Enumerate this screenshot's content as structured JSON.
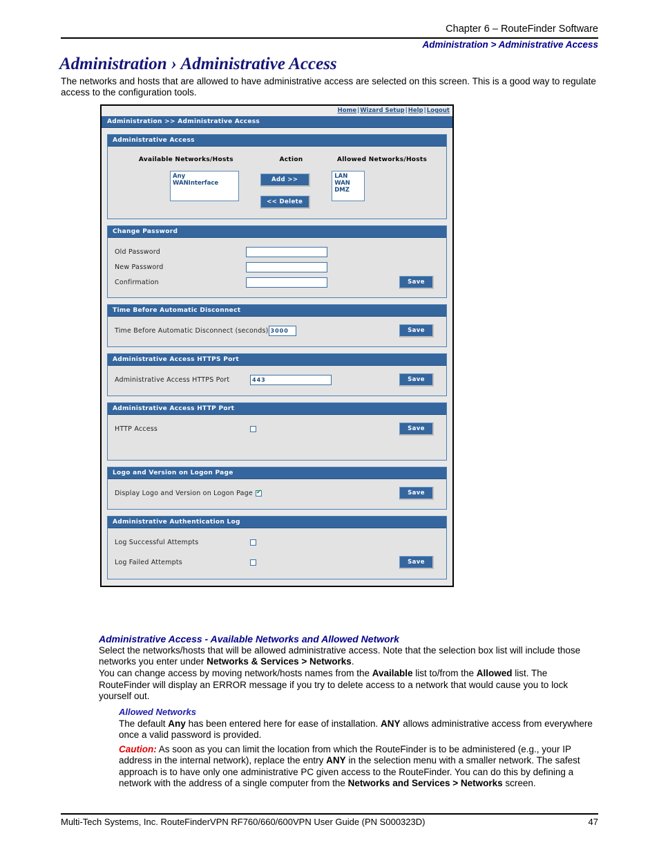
{
  "header": {
    "chapter": "Chapter 6 – RouteFinder Software",
    "breadcrumb": "Administration > Administrative Access"
  },
  "page_title": "Administration › Administrative Access",
  "intro": "The networks and hosts that are allowed to have administrative access are selected on this screen. This is a good way to regulate access to the configuration tools.",
  "screenshot": {
    "topnav": {
      "home": "Home",
      "wizard": "Wizard Setup",
      "help": "Help",
      "logout": "Logout",
      "separator": "|"
    },
    "breadcrumb_bar": "Administration >> Administrative Access",
    "panels": {
      "admin_access": {
        "title": "Administrative Access",
        "col_available": "Available Networks/Hosts",
        "col_action": "Action",
        "col_allowed": "Allowed Networks/Hosts",
        "available_items": [
          "Any",
          "WANInterface"
        ],
        "allowed_items": [
          "LAN",
          "WAN",
          "DMZ"
        ],
        "add_button": "Add  >>",
        "delete_button": "<< Delete"
      },
      "change_password": {
        "title": "Change Password",
        "old_label": "Old Password",
        "old_value": "",
        "new_label": "New Password",
        "new_value": "",
        "confirm_label": "Confirmation",
        "confirm_value": "",
        "save": "Save"
      },
      "auto_disconnect": {
        "title": "Time Before Automatic Disconnect",
        "label": "Time Before Automatic Disconnect (seconds)",
        "value": "3000",
        "save": "Save"
      },
      "https_port": {
        "title": "Administrative Access HTTPS Port",
        "label": "Administrative Access HTTPS Port",
        "value": "443",
        "save": "Save"
      },
      "http_port": {
        "title": "Administrative Access HTTP Port",
        "label": "HTTP Access",
        "checked": false,
        "save": "Save"
      },
      "logo_version": {
        "title": "Logo and Version on Logon Page",
        "label": "Display Logo and Version on Logon Page",
        "checked": true,
        "save": "Save"
      },
      "auth_log": {
        "title": "Administrative Authentication Log",
        "success_label": "Log Successful Attempts",
        "success_checked": false,
        "failed_label": "Log Failed Attempts",
        "failed_checked": false,
        "save": "Save"
      }
    }
  },
  "body": {
    "section1_head": "Administrative Access - Available Networks and Allowed Network",
    "section1_p1_a": "Select the networks/hosts that will be allowed administrative access. Note that the selection box list will include those networks you enter under ",
    "section1_p1_b": "Networks & Services > Networks",
    "section1_p1_c": ".",
    "section1_p2_a": "You can change access by moving network/hosts names from the ",
    "section1_p2_b": "Available",
    "section1_p2_c": " list to/from the ",
    "section1_p2_d": "Allowed",
    "section1_p2_e": " list. The RouteFinder will display an ERROR message if you try to delete access to a network that would cause you to lock yourself out.",
    "allowed_head": "Allowed Networks",
    "allowed_p1_a": "The default ",
    "allowed_p1_b": "Any",
    "allowed_p1_c": " has been entered here for ease of installation. ",
    "allowed_p1_d": "ANY",
    "allowed_p1_e": " allows administrative access from everywhere once a valid password is provided.",
    "caution_label": "Caution:",
    "caution_a": " As soon as you can limit the location from which the RouteFinder is to be administered (e.g., your IP address in the internal network), replace the entry ",
    "caution_b": "ANY",
    "caution_c": " in the selection menu with a smaller network. The safest approach is to have only one administrative PC given access to the RouteFinder. You can do this by defining a network with the address of a single computer from the ",
    "caution_d": "Networks and Services > Networks",
    "caution_e": " screen."
  },
  "footer": {
    "text": "Multi-Tech Systems, Inc. RouteFinderVPN RF760/660/600VPN User Guide (PN S000323D)",
    "page_number": "47"
  },
  "colors": {
    "panel_blue": "#35669e",
    "title_navy": "#16167a",
    "link_blue": "#21538c",
    "caution_red": "#e00000",
    "check_green": "#12a012"
  }
}
